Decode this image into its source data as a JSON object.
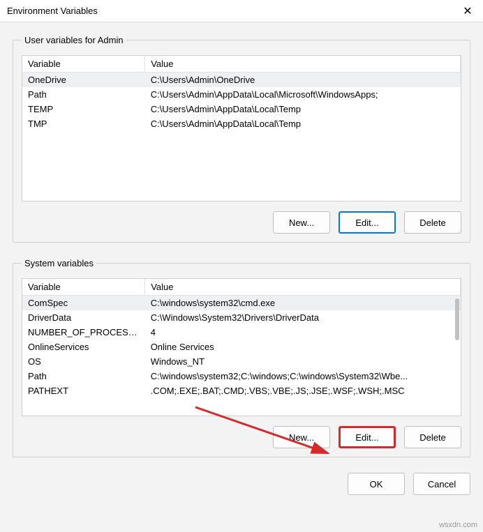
{
  "window": {
    "title": "Environment Variables",
    "close_glyph": "✕"
  },
  "user_section": {
    "legend": "User variables for Admin",
    "col_variable": "Variable",
    "col_value": "Value",
    "rows": [
      {
        "variable": "OneDrive",
        "value": "C:\\Users\\Admin\\OneDrive",
        "selected": true
      },
      {
        "variable": "Path",
        "value": "C:\\Users\\Admin\\AppData\\Local\\Microsoft\\WindowsApps;",
        "selected": false
      },
      {
        "variable": "TEMP",
        "value": "C:\\Users\\Admin\\AppData\\Local\\Temp",
        "selected": false
      },
      {
        "variable": "TMP",
        "value": "C:\\Users\\Admin\\AppData\\Local\\Temp",
        "selected": false
      }
    ],
    "buttons": {
      "new": "New...",
      "edit": "Edit...",
      "delete": "Delete"
    }
  },
  "system_section": {
    "legend": "System variables",
    "col_variable": "Variable",
    "col_value": "Value",
    "rows": [
      {
        "variable": "ComSpec",
        "value": "C:\\windows\\system32\\cmd.exe",
        "selected": true
      },
      {
        "variable": "DriverData",
        "value": "C:\\Windows\\System32\\Drivers\\DriverData",
        "selected": false
      },
      {
        "variable": "NUMBER_OF_PROCESSORS",
        "value": "4",
        "selected": false
      },
      {
        "variable": "OnlineServices",
        "value": "Online Services",
        "selected": false
      },
      {
        "variable": "OS",
        "value": "Windows_NT",
        "selected": false
      },
      {
        "variable": "Path",
        "value": "C:\\windows\\system32;C:\\windows;C:\\windows\\System32\\Wbe...",
        "selected": false
      },
      {
        "variable": "PATHEXT",
        "value": ".COM;.EXE;.BAT;.CMD;.VBS;.VBE;.JS;.JSE;.WSF;.WSH;.MSC",
        "selected": false
      }
    ],
    "buttons": {
      "new": "New...",
      "edit": "Edit...",
      "delete": "Delete"
    }
  },
  "dialog_buttons": {
    "ok": "OK",
    "cancel": "Cancel"
  },
  "watermark": "wsxdn.com"
}
